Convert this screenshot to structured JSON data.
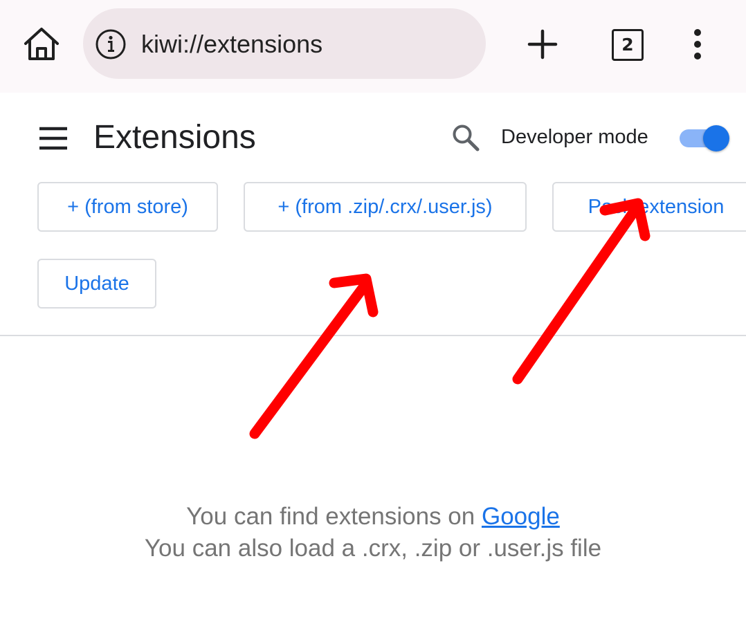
{
  "toolbar": {
    "url": "kiwi://extensions",
    "tab_count": "2",
    "icons": [
      "home-icon",
      "info-icon",
      "plus-icon",
      "tab-switcher-icon",
      "more-vert-icon"
    ]
  },
  "header": {
    "title": "Extensions",
    "developer_mode_label": "Developer mode",
    "developer_mode_on": true,
    "icons": [
      "hamburger-icon",
      "search-icon"
    ]
  },
  "actions": {
    "from_store": "+ (from store)",
    "from_file": "+ (from .zip/.crx/.user.js)",
    "pack_extension": "Pack extension",
    "update": "Update"
  },
  "empty_state": {
    "line1_prefix": "You can find extensions on ",
    "line1_link": "Google",
    "line2": "You can also load a .crx, .zip or .user.js file"
  },
  "colors": {
    "accent": "#1a73e8",
    "toggle_track": "#8ab4f8",
    "annotation_arrow": "#ff0000"
  }
}
